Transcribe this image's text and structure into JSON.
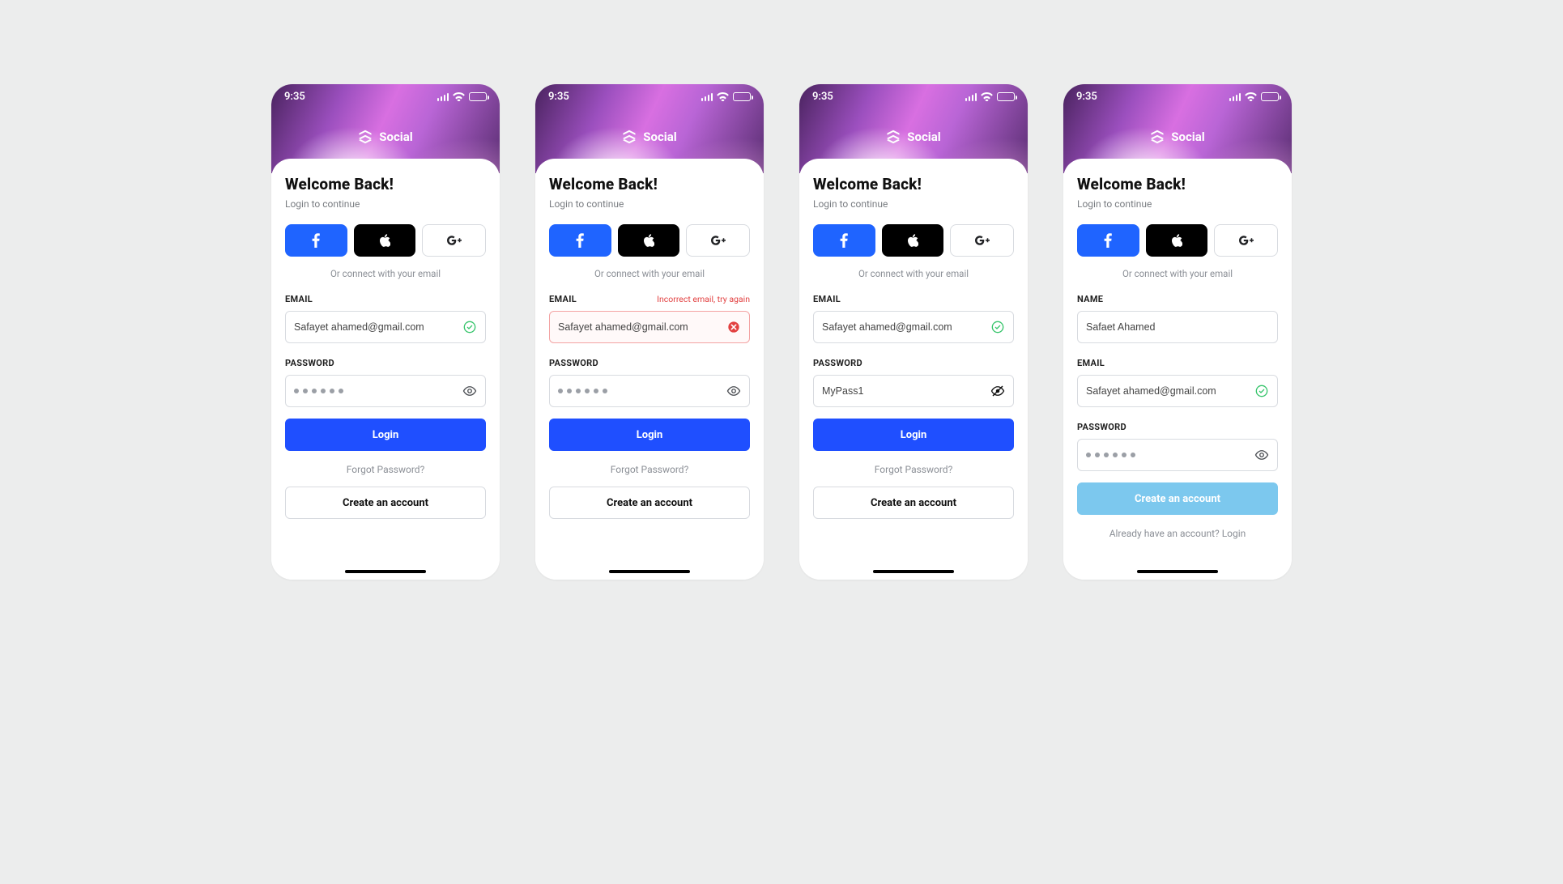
{
  "status": {
    "time": "9:35"
  },
  "brand": {
    "name": "Social"
  },
  "common": {
    "title": "Welcome Back!",
    "subtitle": "Login to continue",
    "connect_text": "Or connect with your email",
    "login_label": "Login",
    "forgot_label": "Forgot Password?",
    "create_label": "Create an account",
    "already_label": "Already have an account? Login"
  },
  "labels": {
    "email": "EMAIL",
    "password": "PASSWORD",
    "name": "NAME"
  },
  "screens": [
    {
      "email_value": "Safayet ahamed@gmail.com",
      "email_state": "valid",
      "password_masked": true,
      "password_dots": 6,
      "password_trail": "eye"
    },
    {
      "email_value": "Safayet ahamed@gmail.com",
      "email_state": "error",
      "email_error": "Incorrect email, try again",
      "password_masked": true,
      "password_dots": 6,
      "password_trail": "eye"
    },
    {
      "email_value": "Safayet ahamed@gmail.com",
      "email_state": "valid",
      "password_masked": false,
      "password_value": "MyPass1",
      "password_trail": "eye-off"
    },
    {
      "name_value": "Safaet Ahamed",
      "email_value": "Safayet ahamed@gmail.com",
      "email_state": "valid",
      "password_masked": true,
      "password_dots": 6,
      "password_trail": "eye"
    }
  ]
}
